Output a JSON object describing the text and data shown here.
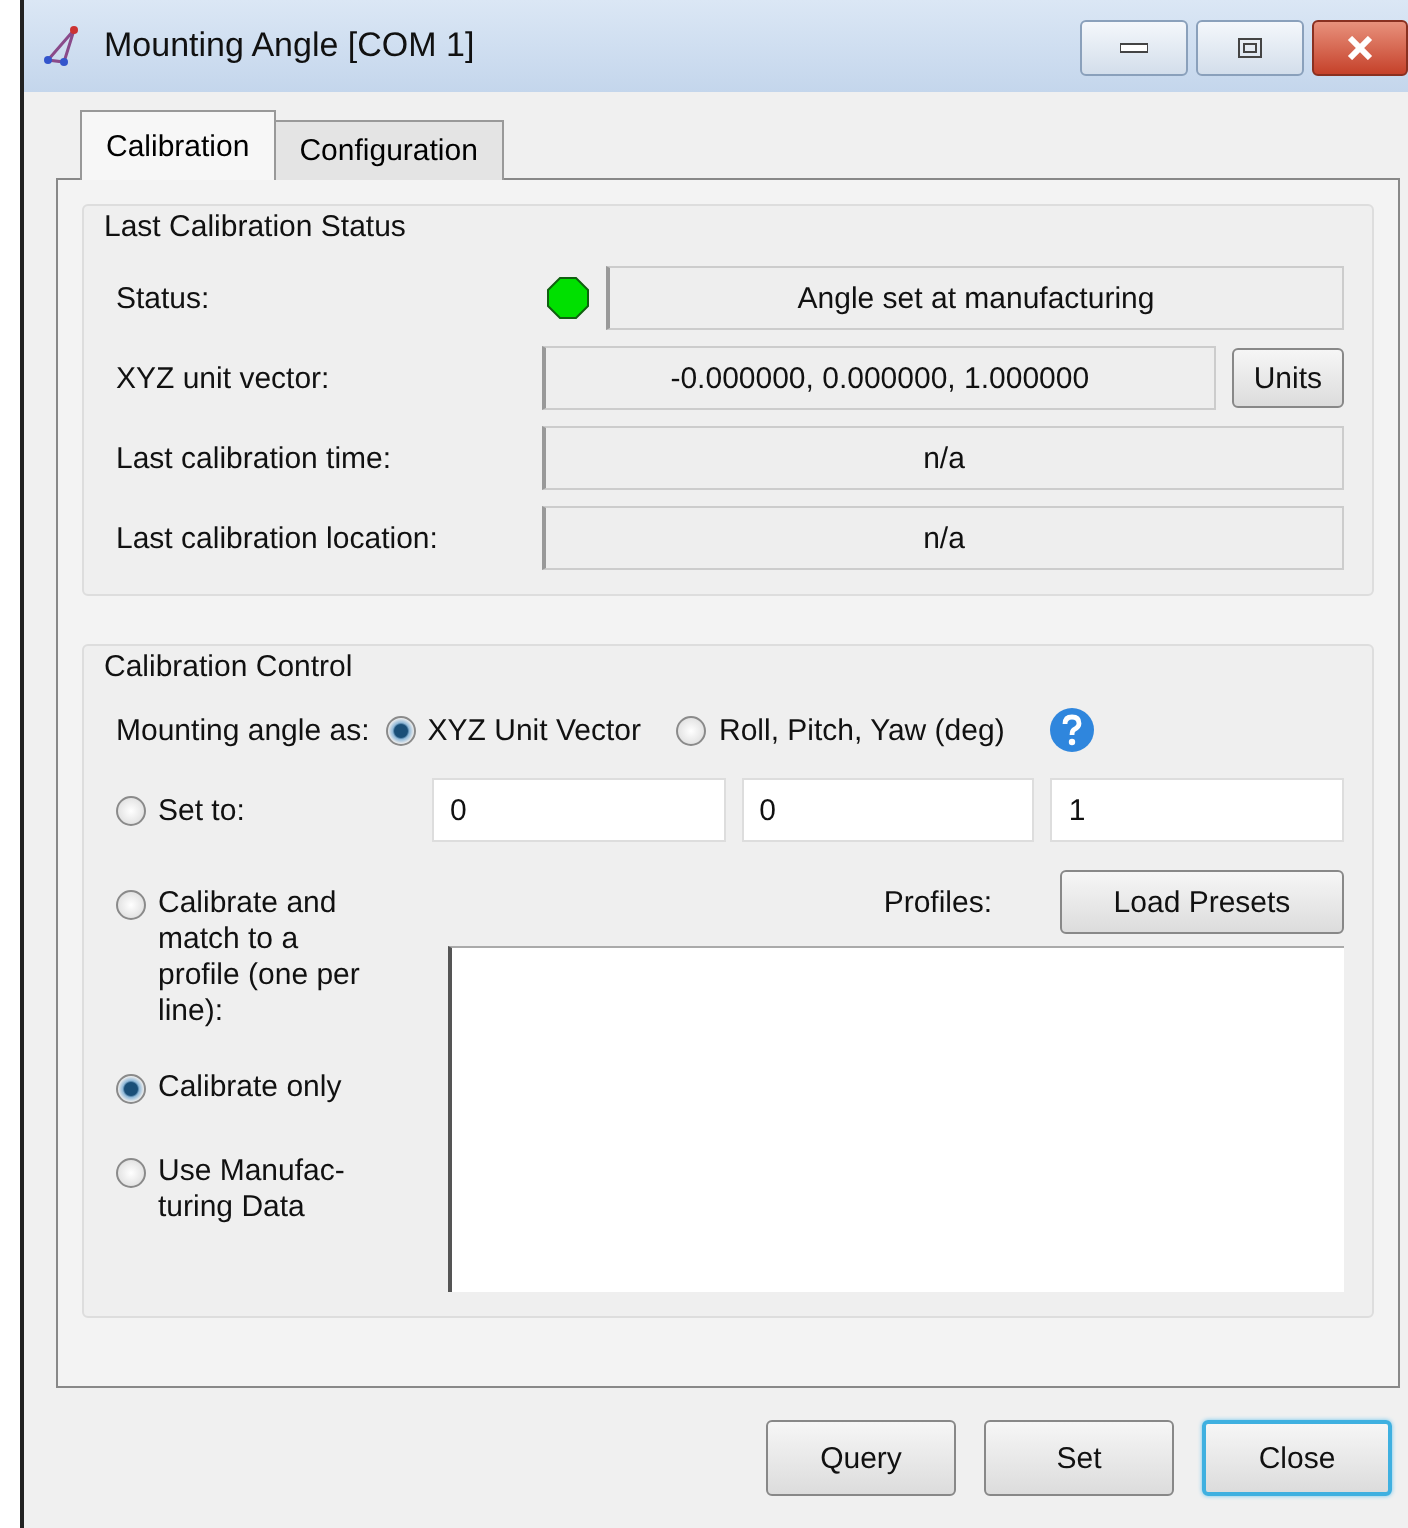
{
  "window": {
    "title": "Mounting Angle [COM 1]"
  },
  "tabs": [
    {
      "label": "Calibration",
      "selected": true
    },
    {
      "label": "Configuration",
      "selected": false
    }
  ],
  "last_status": {
    "title": "Last Calibration Status",
    "status": {
      "label": "Status:",
      "color": "#00e000",
      "value": "Angle set at manufacturing"
    },
    "vector": {
      "label": "XYZ unit vector:",
      "value": "-0.000000, 0.000000, 1.000000",
      "button": "Units"
    },
    "time": {
      "label": "Last calibration time:",
      "value": "n/a"
    },
    "location": {
      "label": "Last calibration location:",
      "value": "n/a"
    }
  },
  "control": {
    "title": "Calibration Control",
    "mode_label": "Mounting angle as:",
    "modes": [
      {
        "label": "XYZ Unit Vector",
        "selected": true
      },
      {
        "label": "Roll, Pitch, Yaw (deg)",
        "selected": false
      }
    ],
    "set_to": {
      "label": "Set to:",
      "selected": false,
      "values": [
        "0",
        "0",
        "1"
      ]
    },
    "actions": [
      {
        "label": "Calibrate and\nmatch to a\nprofile (one per\nline):",
        "selected": false
      },
      {
        "label": "Calibrate only",
        "selected": true
      },
      {
        "label": "Use Manufac-\nturing Data",
        "selected": false
      }
    ],
    "profiles_label": "Profiles:",
    "load_button": "Load Presets"
  },
  "buttons": [
    {
      "label": "Query",
      "default": false
    },
    {
      "label": "Set",
      "default": false
    },
    {
      "label": "Close",
      "default": true
    }
  ]
}
